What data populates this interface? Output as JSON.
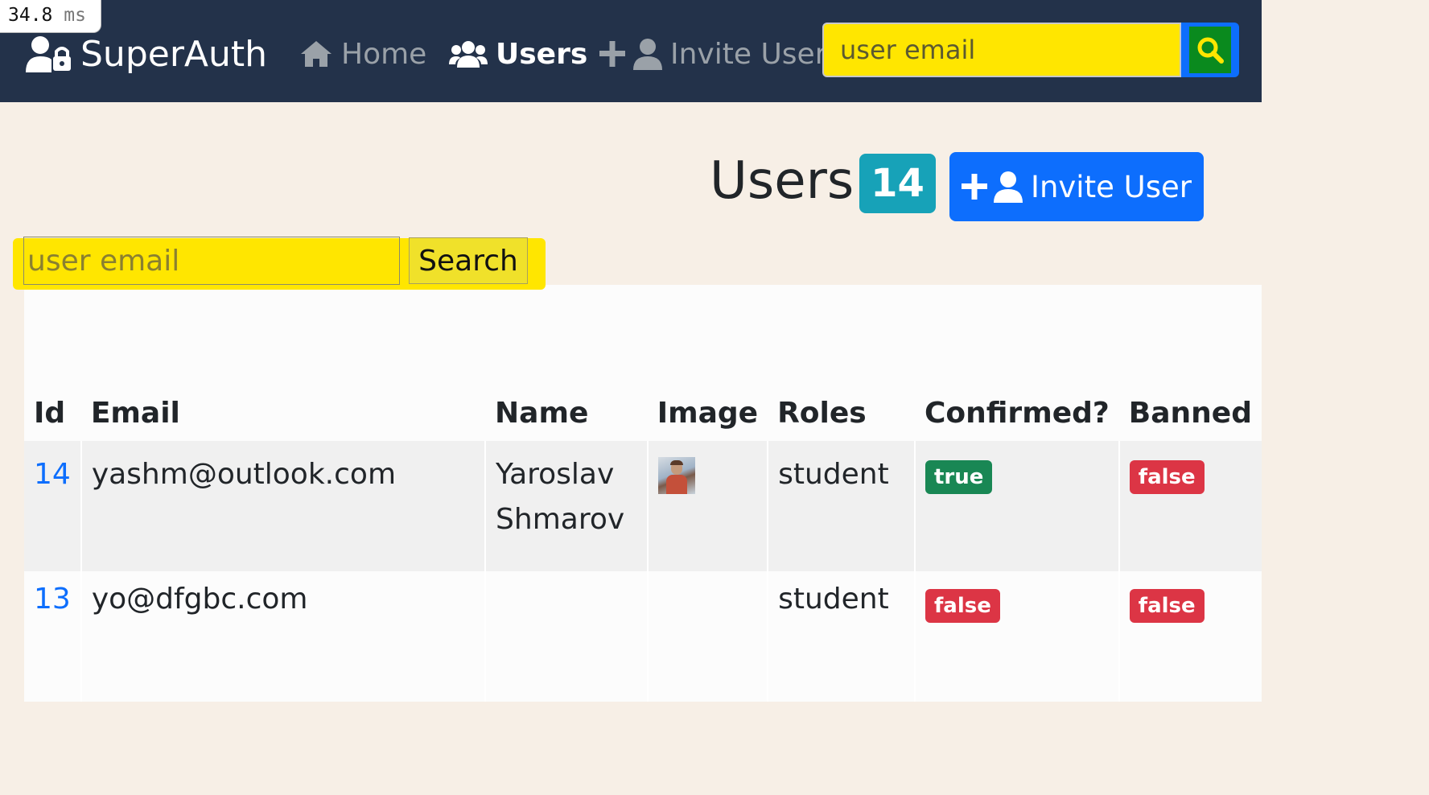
{
  "timing": {
    "value": "34.8",
    "unit": "ms"
  },
  "nav": {
    "brand": "SuperAuth",
    "home": "Home",
    "users": "Users",
    "invite": "Invite User",
    "search_placeholder": "user email",
    "search_highlight_color": "#ffe600"
  },
  "header": {
    "title": "Users:",
    "count": "14",
    "invite_label": "Invite User"
  },
  "search": {
    "placeholder": "user email",
    "button": "Search"
  },
  "table": {
    "columns": [
      "Id",
      "Email",
      "Name",
      "Image",
      "Roles",
      "Confirmed?",
      "Banned"
    ],
    "rows": [
      {
        "id": "14",
        "email": "yashm@outlook.com",
        "name_first": "Yaroslav",
        "name_last": "Shmarov",
        "has_image": true,
        "roles": "student",
        "confirmed": "true",
        "banned": "false"
      },
      {
        "id": "13",
        "email": "yo@dfgbc.com",
        "name_first": "",
        "name_last": "",
        "has_image": false,
        "roles": "student",
        "confirmed": "false",
        "banned": "false"
      }
    ]
  },
  "colors": {
    "navbar": "#23324a",
    "primary": "#0d6efd",
    "info_badge": "#17a2b8",
    "success": "#198754",
    "danger": "#dc3545"
  }
}
